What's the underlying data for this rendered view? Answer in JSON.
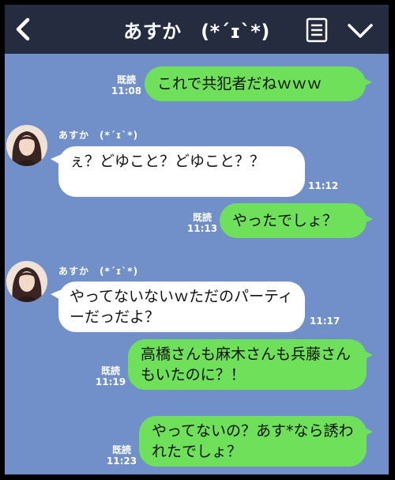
{
  "header": {
    "title": "あすか　(*´ɪ`*)"
  },
  "contact": {
    "name": "あすか　(*´ɪ`*)"
  },
  "messages": [
    {
      "type": "out",
      "read": "既読",
      "time": "11:08",
      "text": "これで共犯者だねｗｗｗ"
    },
    {
      "type": "in",
      "time": "11:12",
      "text": "ぇ？どゆこと？どゆこと？？"
    },
    {
      "type": "out",
      "read": "既読",
      "time": "11:13",
      "text": "やったでしょ？"
    },
    {
      "type": "in",
      "time": "11:17",
      "text": "やってないないｗただのパーティーだっだよ？"
    },
    {
      "type": "out",
      "read": "既読",
      "time": "11:19",
      "text": "高橋さんも麻木さんも兵藤さんもいたのに？！"
    },
    {
      "type": "out",
      "read": "既読",
      "time": "11:23",
      "text": "やってないの？あす*なら誘われたでしょ？"
    }
  ],
  "colors": {
    "background": "#7190c9",
    "header": "#252c3f",
    "outgoing_bubble": "#6ee05a",
    "incoming_bubble": "#ffffff"
  },
  "icons": {
    "back": "back-arrow-icon",
    "menu": "list-menu-icon",
    "more": "chevron-down-icon"
  }
}
